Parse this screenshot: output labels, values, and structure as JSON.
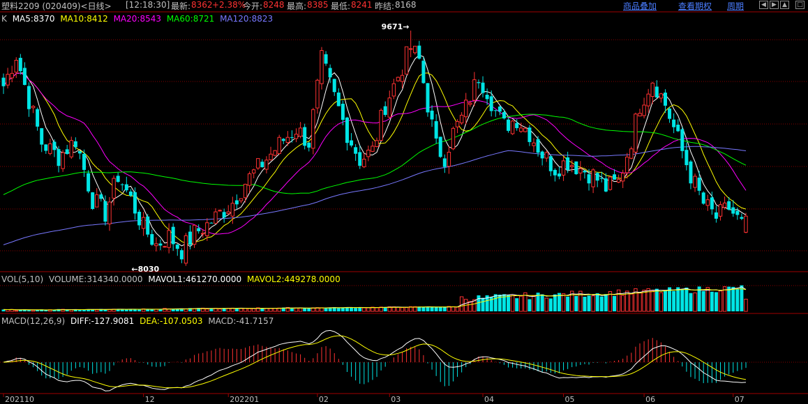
{
  "header": {
    "instrument": "塑料2209 (020409)<日线>",
    "time": "[12:18:30]",
    "latest_label": "最新:",
    "latest_value": "8362",
    "change_pct": "+2.38%",
    "open_label": "今开:",
    "open_value": "8248",
    "high_label": "最高:",
    "high_value": "8385",
    "low_label": "最低:",
    "low_value": "8241",
    "prev_label": "昨结:",
    "prev_value": "8168",
    "links": [
      "商品叠加",
      "查看期权",
      "周期"
    ],
    "nav_icons": [
      "arrow-left-icon",
      "arrow-right-icon",
      "up-icon",
      "square-icon"
    ]
  },
  "colors": {
    "up": "#ff3232",
    "down": "#00e5e5",
    "ma5": "#ffffff",
    "ma10": "#ffff00",
    "ma20": "#ff00ff",
    "ma60": "#00ff00",
    "ma120": "#7878ff",
    "link": "#4a7dff"
  },
  "price_legend": {
    "prefix": "K",
    "items": [
      {
        "text": "MA5:8370",
        "color": "#ffffff"
      },
      {
        "text": "MA10:8412",
        "color": "#ffff00"
      },
      {
        "text": "MA20:8543",
        "color": "#ff00ff"
      },
      {
        "text": "MA60:8721",
        "color": "#00ff00"
      },
      {
        "text": "MA120:8823",
        "color": "#7878ff"
      }
    ]
  },
  "vol_legend": {
    "items": [
      {
        "text": "VOL(5,10)",
        "color": "#c0c0c0"
      },
      {
        "text": "VOLUME:314340.0000",
        "color": "#c0c0c0"
      },
      {
        "text": "MAVOL1:461270.0000",
        "color": "#ffffff"
      },
      {
        "text": "MAVOL2:449278.0000",
        "color": "#ffff00"
      }
    ]
  },
  "macd_legend": {
    "items": [
      {
        "text": "MACD(12,26,9)",
        "color": "#c0c0c0"
      },
      {
        "text": "DIFF:-127.9081",
        "color": "#ffffff"
      },
      {
        "text": "DEA:-107.0503",
        "color": "#ffff00"
      },
      {
        "text": "MACD:-41.7157",
        "color": "#c0c0c0"
      }
    ]
  },
  "chart_data": {
    "type": "candlestick",
    "price_range": [
      7980,
      9700
    ],
    "high_marker": {
      "label": "9671→",
      "value": 9671
    },
    "low_marker": {
      "label": "←8030",
      "value": 8030
    },
    "x_labels": [
      {
        "text": "202110",
        "index": 0
      },
      {
        "text": "12",
        "index": 33
      },
      {
        "text": "202201",
        "index": 53
      },
      {
        "text": "02",
        "index": 74
      },
      {
        "text": "03",
        "index": 91
      },
      {
        "text": "04",
        "index": 113
      },
      {
        "text": "05",
        "index": 132
      },
      {
        "text": "06",
        "index": 151
      },
      {
        "text": "07",
        "index": 172
      }
    ],
    "anchors": [
      [
        0,
        9280
      ],
      [
        3,
        9500
      ],
      [
        6,
        9180
      ],
      [
        9,
        8880
      ],
      [
        13,
        8780
      ],
      [
        17,
        8900
      ],
      [
        21,
        8480
      ],
      [
        24,
        8380
      ],
      [
        27,
        8650
      ],
      [
        30,
        8480
      ],
      [
        33,
        8280
      ],
      [
        36,
        8160
      ],
      [
        39,
        8220
      ],
      [
        42,
        8120
      ],
      [
        45,
        8240
      ],
      [
        48,
        8300
      ],
      [
        51,
        8380
      ],
      [
        54,
        8460
      ],
      [
        57,
        8600
      ],
      [
        60,
        8700
      ],
      [
        63,
        8800
      ],
      [
        66,
        8900
      ],
      [
        69,
        8980
      ],
      [
        72,
        8880
      ],
      [
        75,
        9460
      ],
      [
        78,
        9200
      ],
      [
        81,
        8950
      ],
      [
        84,
        8760
      ],
      [
        87,
        8820
      ],
      [
        90,
        9150
      ],
      [
        93,
        9350
      ],
      [
        96,
        9550
      ],
      [
        98,
        9460
      ],
      [
        100,
        9150
      ],
      [
        102,
        8850
      ],
      [
        104,
        8780
      ],
      [
        106,
        8950
      ],
      [
        108,
        9050
      ],
      [
        110,
        9200
      ],
      [
        112,
        9350
      ],
      [
        114,
        9250
      ],
      [
        116,
        9100
      ],
      [
        118,
        9000
      ],
      [
        121,
        9050
      ],
      [
        124,
        8950
      ],
      [
        127,
        8800
      ],
      [
        130,
        8700
      ],
      [
        133,
        8750
      ],
      [
        136,
        8700
      ],
      [
        139,
        8650
      ],
      [
        142,
        8560
      ],
      [
        145,
        8600
      ],
      [
        148,
        8900
      ],
      [
        150,
        9150
      ],
      [
        153,
        9330
      ],
      [
        156,
        9150
      ],
      [
        159,
        8900
      ],
      [
        162,
        8650
      ],
      [
        165,
        8450
      ],
      [
        168,
        8350
      ],
      [
        171,
        8420
      ],
      [
        174,
        8300
      ],
      [
        175,
        8362
      ]
    ],
    "ma_final": {
      "ma5": 8370,
      "ma10": 8412,
      "ma20": 8543,
      "ma60": 8721,
      "ma120": 8823
    }
  }
}
